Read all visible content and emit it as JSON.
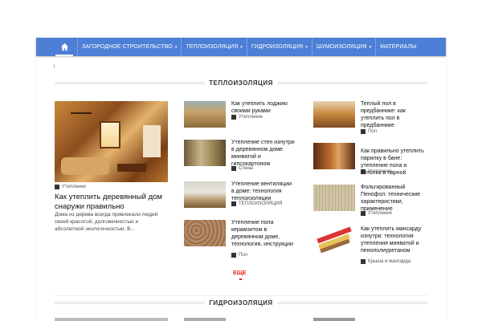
{
  "nav": {
    "home_icon": "home-icon",
    "items": [
      {
        "label": "ЗАГОРОДНОЕ СТРОИТЕЛЬСТВО",
        "has_dropdown": true
      },
      {
        "label": "ТЕПЛОИЗОЛЯЦИЯ",
        "has_dropdown": true
      },
      {
        "label": "ГИДРОИЗОЛЯЦИЯ",
        "has_dropdown": true
      },
      {
        "label": "ШУМОИЗОЛЯЦИЯ",
        "has_dropdown": true
      },
      {
        "label": "МАТЕРИАЛЫ",
        "has_dropdown": false
      }
    ],
    "caret": "▾",
    "color": "#4e7fd6"
  },
  "section1": {
    "title": "ТЕПЛОИЗОЛЯЦИЯ",
    "featured": {
      "title": "Как утеплить деревянный дом снаружи правильно",
      "excerpt": "Дома из дерева всегда привлекали людей своей красотой, долговечностью и абсолютной экологичностью. В...",
      "category": "Утепление"
    },
    "middle": [
      {
        "title": "Как утеплить лоджию своими руками",
        "category": "Утепление"
      },
      {
        "title": "Утепление стен изнутри в деревянном доме минватой и гипсокартоном",
        "category": "Стены"
      },
      {
        "title": "Утепление вентиляции в доме: технология теплоизоляции",
        "category": "ТЕПЛОИЗОЛЯЦИЯ"
      },
      {
        "title": "Утепление пола керамзитом в деревянном доме, технология, инструкции",
        "category": "Пол"
      }
    ],
    "right": [
      {
        "title": "Теплый пол в предбаннике: как утеплить пол в предбаннике",
        "category": "Пол"
      },
      {
        "title": "Как правильно утеплить парилку в бане: утепление пола и потолка в парной",
        "category": "Утепление"
      },
      {
        "title": "Фольгированный Пенофол: технические характеристики, применение",
        "category": "Утепление"
      },
      {
        "title": "Как утеплить мансарду изнутри: технология утепления минватой и пенополиуретаном",
        "category": "Крыша и мансарда"
      }
    ],
    "more_label": "ЕЩЕ",
    "more_color": "#e22222"
  },
  "section2": {
    "title": "ГИДРОИЗОЛЯЦИЯ"
  }
}
